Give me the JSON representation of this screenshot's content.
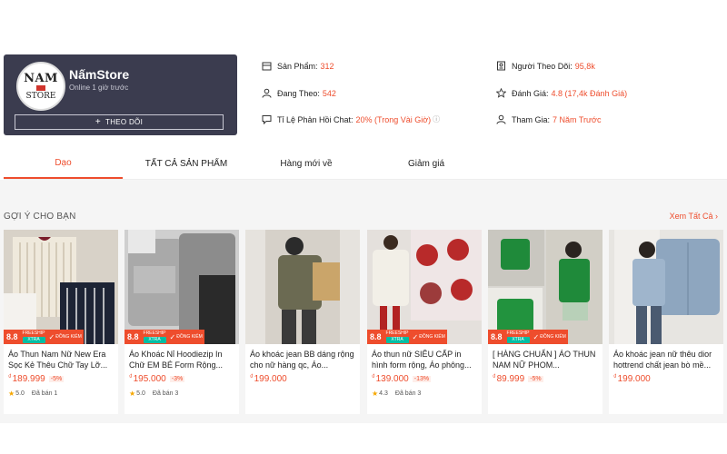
{
  "shop": {
    "logo_line1": "NAM",
    "logo_line2": "STORE",
    "name": "NấmStore",
    "online": "Online 1 giờ trước",
    "follow_label": "THEO DÕI"
  },
  "stats": {
    "products_label": "Sản Phẩm:",
    "products_value": "312",
    "following_label": "Đang Theo:",
    "following_value": "542",
    "chat_label": "Tỉ Lệ Phản Hồi Chat:",
    "chat_value": "20% (Trong Vài Giờ)",
    "followers_label": "Người Theo Dõi:",
    "followers_value": "95,8k",
    "rating_label": "Đánh Giá:",
    "rating_value": "4.8 (17,4k Đánh Giá)",
    "joined_label": "Tham Gia:",
    "joined_value": "7 Năm Trước"
  },
  "tabs": [
    "Dạo",
    "TẤT CẢ SẢN PHẨM",
    "Hàng mới về",
    "Giảm giá"
  ],
  "section": {
    "title": "GỢI Ý CHO BẠN",
    "see_all": "Xem Tất Cả"
  },
  "badge": {
    "sale": "8.8",
    "freeship": "FREESHIP",
    "freeship_chip": "XTRA",
    "dong_kiem": "ĐỒNG KIỂM"
  },
  "currency": "₫",
  "products": [
    {
      "name": "Áo Thun Nam Nữ New Era Sọc Kẻ Thêu Chữ Tay Lỡ...",
      "price": "189.999",
      "discount": "-5%",
      "rating": "5.0",
      "sold": "Đã bán 1"
    },
    {
      "name": "Áo Khoác Nỉ Hoodiezip In Chữ EM BÉ Form Rộng...",
      "price": "195.000",
      "discount": "-3%",
      "rating": "5.0",
      "sold": "Đã bán 3"
    },
    {
      "name": "Áo khoác jean BB dáng rộng cho nữ hàng qc, Áo...",
      "price": "199.000",
      "discount": "",
      "rating": "",
      "sold": ""
    },
    {
      "name": "Áo thun nữ SIÊU CẤP in hình form rộng, Áo phông...",
      "price": "139.000",
      "discount": "-13%",
      "rating": "4.3",
      "sold": "Đã bán 3"
    },
    {
      "name": "[ HÀNG CHUẨN ] ÁO THUN NAM NỮ PHOM...",
      "price": "89.999",
      "discount": "-5%",
      "rating": "",
      "sold": ""
    },
    {
      "name": "Áo khoác jean nữ thêu dior hottrend chất jean bò mề...",
      "price": "199.000",
      "discount": "",
      "rating": "",
      "sold": ""
    }
  ]
}
